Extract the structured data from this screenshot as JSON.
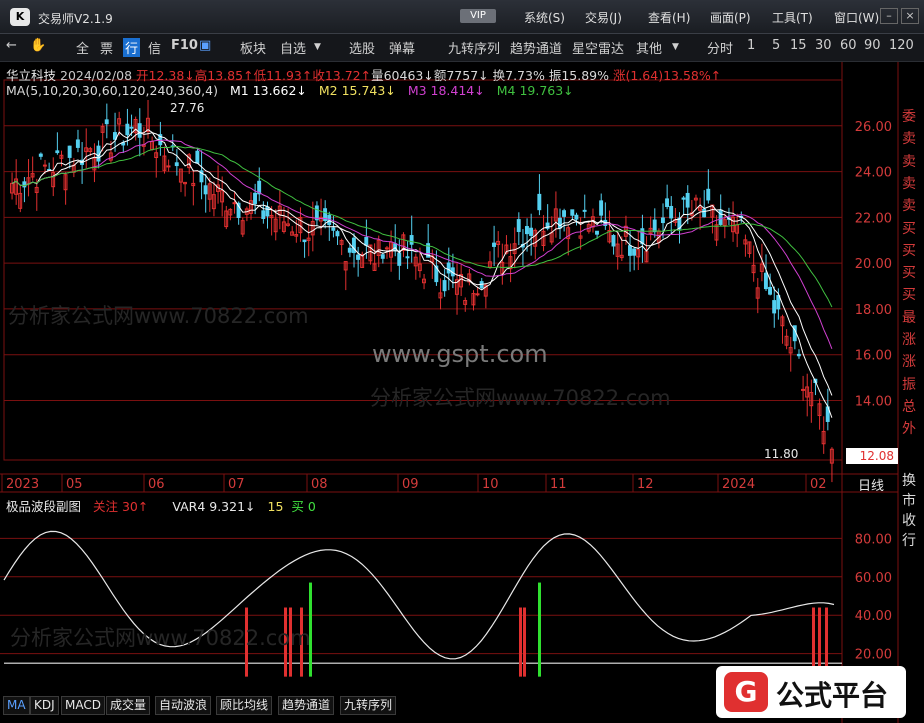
{
  "app": {
    "title": "交易师V2.1.9",
    "vip": "VIP"
  },
  "menus": [
    "系统(S)",
    "交易(J)",
    "查看(H)",
    "画面(P)",
    "工具(T)",
    "窗口(W)"
  ],
  "toolbar": {
    "items": [
      "全",
      "票",
      "行",
      "信",
      "F10"
    ],
    "items2": [
      "板块",
      "自选",
      "选股",
      "弹幕",
      "九转序列",
      "趋势通道",
      "星空雷达",
      "其他"
    ],
    "periods": [
      "分时",
      "1",
      "5",
      "15",
      "30",
      "60",
      "90",
      "120"
    ]
  },
  "quote": {
    "name": "华立科技",
    "date": "2024/02/08",
    "open": "开12.38↓",
    "high": "高13.85↑",
    "low": "低11.93↑",
    "close": "收13.72↑",
    "vol": "量60463↓",
    "amount": "额7757↓",
    "turnover": "换7.73%",
    "amp": "振15.89%",
    "change": "涨(1.64)13.58%↑"
  },
  "ma_line": {
    "label": "MA(5,10,20,30,60,120,240,360,4)",
    "m1": "M1 13.662↓",
    "m2": "M2 15.743↓",
    "m3": "M3 18.414↓",
    "m4": "M4 19.763↓"
  },
  "price_axis": [
    "26.00",
    "24.00",
    "22.00",
    "20.00",
    "18.00",
    "16.00",
    "14.00"
  ],
  "current_price": "12.08",
  "high_mark": "27.76",
  "low_mark": "11.80",
  "time_axis": [
    "2023",
    "05",
    "06",
    "07",
    "08",
    "09",
    "10",
    "11",
    "12",
    "2024",
    "02"
  ],
  "period_label": "日线",
  "right_panel": [
    "委",
    "卖",
    "卖",
    "卖",
    "卖",
    "买",
    "买",
    "买",
    "买",
    "最",
    "涨",
    "涨",
    "振",
    "总",
    "外"
  ],
  "right_panel2": [
    "换",
    "市",
    "收",
    "行"
  ],
  "indicator": {
    "name": "极品波段副图",
    "watch": "关注 30↑",
    "var4": "VAR4 9.321↓",
    "fifteen": "15",
    "buy": "买 0",
    "axis": [
      "80.00",
      "60.00",
      "40.00",
      "20.00"
    ]
  },
  "bottom_tabs": [
    "MA",
    "KDJ",
    "MACD",
    "成交量",
    "自动波浪",
    "顾比均线",
    "趋势通道",
    "九转序列"
  ],
  "watermarks": {
    "site": "www.gspt.com",
    "line": "分析家公式网www.70822.com"
  },
  "logo_text": "公式平台",
  "colors": {
    "up": "#e03030",
    "down": "#54d0f0",
    "m1": "#ffffff",
    "m2": "#f0e060",
    "m3": "#d040d0",
    "m4": "#40c040",
    "grid": "#7a1010"
  }
}
